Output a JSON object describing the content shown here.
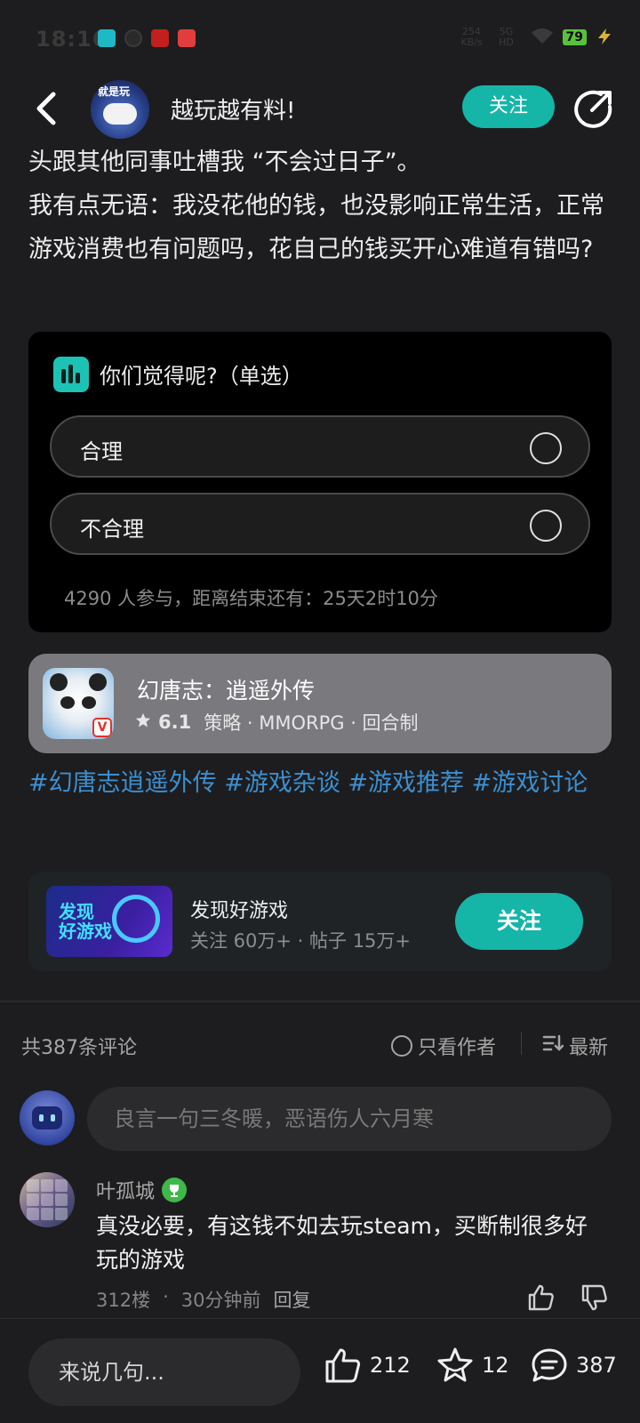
{
  "status_bar": {
    "time": "18:16",
    "net_speed_value": "254",
    "net_speed_unit": "KB/s",
    "network": "5G HD",
    "battery": "79"
  },
  "header": {
    "avatar_tag": "就是玩",
    "title": "越玩越有料!",
    "follow_label": "关注"
  },
  "post": {
    "lines": [
      "头跟其他同事吐槽我 “不会过日子”。",
      "我有点无语：我没花他的钱，也没影响正常生活，正常游戏消费也有问题吗，花自己的钱买开心难道有错吗?"
    ]
  },
  "vote": {
    "title": "你们觉得呢?（单选）",
    "options": [
      "合理",
      "不合理"
    ],
    "footer": "4290 人参与，距离结束还有：25天2时10分"
  },
  "game": {
    "name": "幻唐志：逍遥外传",
    "rating": "6.1",
    "tags": "策略 · MMORPG · 回合制",
    "badge": "V"
  },
  "hashtags": "#幻唐志逍遥外传 #游戏杂谈 #游戏推荐 #游戏讨论",
  "channel": {
    "image_text": "发现\n好游戏",
    "name": "发现好游戏",
    "meta": "关注 60万+ · 帖子 15万+",
    "follow_label": "关注"
  },
  "comments": {
    "count_label": "共387条评论",
    "filter_label": "只看作者",
    "sort_label": "最新",
    "input_placeholder": "良言一句三冬暖，恶语伤人六月寒",
    "items": [
      {
        "author": "叶孤城",
        "text": "真没必要，有这钱不如去玩steam，买断制很多好玩的游戏",
        "floor": "312楼",
        "time": "30分钟前",
        "reply_label": "回复"
      }
    ]
  },
  "bottom_bar": {
    "input_placeholder": "来说几句...",
    "likes": "212",
    "favorites": "12",
    "comments": "387"
  },
  "colors": {
    "accent": "#15b5a8",
    "hashtag": "#3d8fd0",
    "background": "#1d1d1f"
  }
}
